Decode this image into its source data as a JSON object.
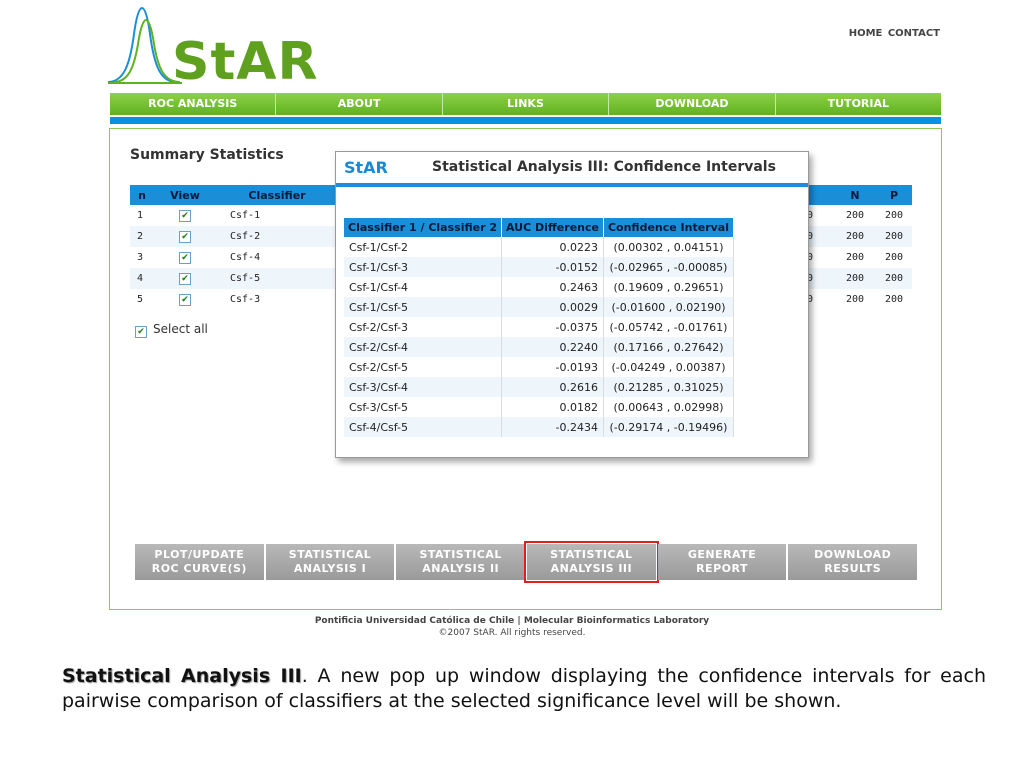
{
  "logo": {
    "text": "StAR"
  },
  "topnav": {
    "home": "HOME",
    "contact": "CONTACT"
  },
  "mainnav": [
    "ROC ANALYSIS",
    "ABOUT",
    "LINKS",
    "DOWNLOAD",
    "TUTORIAL"
  ],
  "summary": {
    "title": "Summary Statistics",
    "headers": {
      "n": "n",
      "view": "View",
      "classifier": "Classifier",
      "N": "N",
      "P": "P"
    },
    "rows": [
      {
        "n": "1",
        "classifier": "Csf-1",
        "N": "200",
        "P": "200"
      },
      {
        "n": "2",
        "classifier": "Csf-2",
        "N": "200",
        "P": "200"
      },
      {
        "n": "3",
        "classifier": "Csf-4",
        "N": "200",
        "P": "200"
      },
      {
        "n": "4",
        "classifier": "Csf-5",
        "N": "200",
        "P": "200"
      },
      {
        "n": "5",
        "classifier": "Csf-3",
        "N": "200",
        "P": "200"
      }
    ],
    "partial_col": [
      "0",
      "0",
      "0",
      "0",
      "0"
    ],
    "select_all": "Select all",
    "check": "✔"
  },
  "popup": {
    "brand": "StAR",
    "title": "Statistical Analysis III: Confidence Intervals",
    "headers": {
      "pair": "Classifier 1 / Classifier 2",
      "diff": "AUC Difference",
      "interval": "Confidence Interval"
    },
    "rows": [
      {
        "pair": "Csf-1/Csf-2",
        "diff": "0.0223",
        "interval": "(0.00302 , 0.04151)"
      },
      {
        "pair": "Csf-1/Csf-3",
        "diff": "-0.0152",
        "interval": "(-0.02965 , -0.00085)"
      },
      {
        "pair": "Csf-1/Csf-4",
        "diff": "0.2463",
        "interval": "(0.19609 , 0.29651)"
      },
      {
        "pair": "Csf-1/Csf-5",
        "diff": "0.0029",
        "interval": "(-0.01600 , 0.02190)"
      },
      {
        "pair": "Csf-2/Csf-3",
        "diff": "-0.0375",
        "interval": "(-0.05742 , -0.01761)"
      },
      {
        "pair": "Csf-2/Csf-4",
        "diff": "0.2240",
        "interval": "(0.17166 , 0.27642)"
      },
      {
        "pair": "Csf-2/Csf-5",
        "diff": "-0.0193",
        "interval": "(-0.04249 , 0.00387)"
      },
      {
        "pair": "Csf-3/Csf-4",
        "diff": "0.2616",
        "interval": "(0.21285 , 0.31025)"
      },
      {
        "pair": "Csf-3/Csf-5",
        "diff": "0.0182",
        "interval": "(0.00643 , 0.02998)"
      },
      {
        "pair": "Csf-4/Csf-5",
        "diff": "-0.2434",
        "interval": "(-0.29174 , -0.19496)"
      }
    ]
  },
  "buttons": {
    "plot": "PLOT/UPDATE\nROC CURVE(S)",
    "sa1": "STATISTICAL\nANALYSIS I",
    "sa2": "STATISTICAL\nANALYSIS II",
    "sa3": "STATISTICAL\nANALYSIS III",
    "report": "GENERATE\nREPORT",
    "download": "DOWNLOAD\nRESULTS"
  },
  "footer": {
    "line1": "Pontificia Universidad Católica de Chile  |  Molecular Bioinformatics Laboratory",
    "line2": "©2007 StAR. All rights reserved."
  },
  "caption": {
    "bold": "Statistical Analysis III",
    "text": ". A new pop up window displaying the confidence intervals for each pairwise comparison of classifiers at the selected significance level will be shown."
  },
  "colors": {
    "green": "#5fb21f",
    "blue": "#1a8fd8",
    "highlight": "#e02020"
  }
}
